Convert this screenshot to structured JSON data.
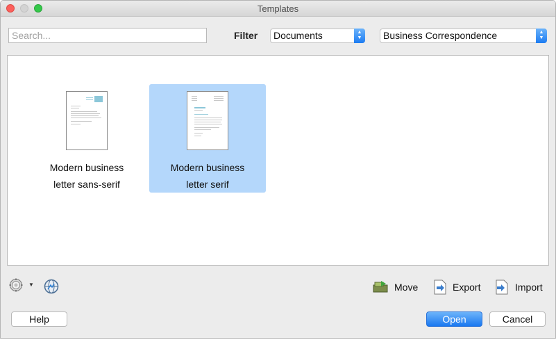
{
  "window": {
    "title": "Templates"
  },
  "search": {
    "placeholder": "Search...",
    "value": ""
  },
  "filter": {
    "label": "Filter",
    "type_selected": "Documents",
    "category_selected": "Business Correspondence"
  },
  "templates": [
    {
      "line1": "Modern business",
      "line2": "letter sans-serif",
      "selected": false
    },
    {
      "line1": "Modern business",
      "line2": "letter serif",
      "selected": true
    }
  ],
  "toolbar": {
    "settings_icon": "gear-icon",
    "online_icon": "globe-icon",
    "move_label": "Move",
    "export_label": "Export",
    "import_label": "Import"
  },
  "buttons": {
    "help": "Help",
    "open": "Open",
    "cancel": "Cancel"
  },
  "colors": {
    "accent": "#1d7cf2",
    "selection": "#b4d7fb",
    "thumb_accent": "#8cc7d9"
  }
}
